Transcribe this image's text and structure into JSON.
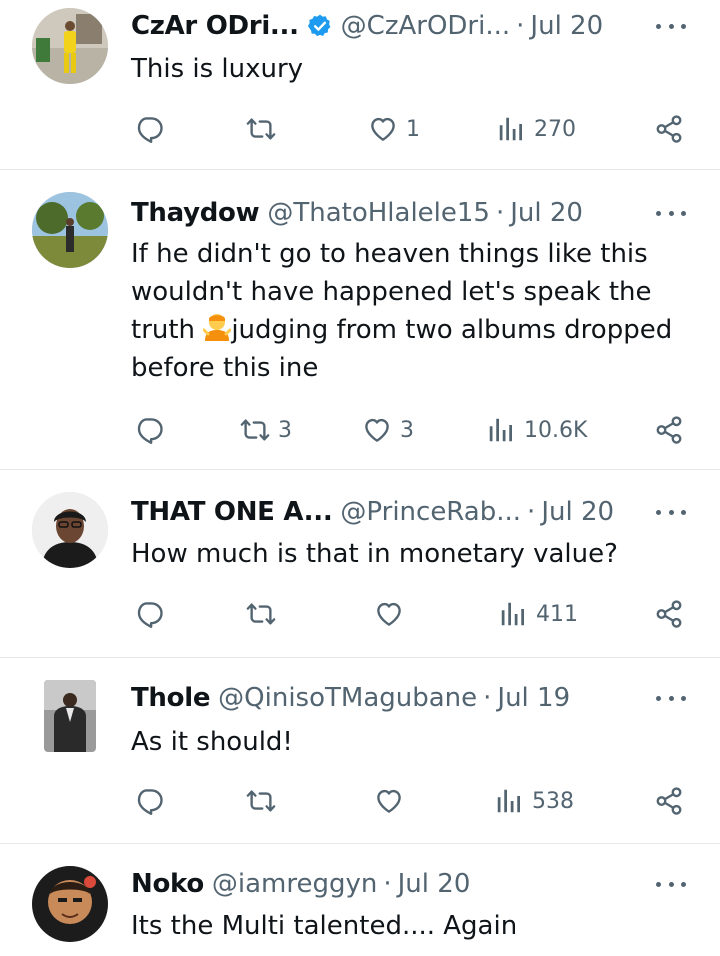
{
  "tweets": [
    {
      "name": "CzAr ODri...",
      "verified": true,
      "handle": "@CzArODri...",
      "sep": "·",
      "date": "Jul 20",
      "text": "This is luxury",
      "replies": "",
      "retweets": "",
      "likes": "1",
      "views": "270"
    },
    {
      "name": "Thaydow",
      "verified": false,
      "handle": "@ThatoHlalele15",
      "sep": "·",
      "date": "Jul 20",
      "text_lines": [
        "If he didn't go to heaven things like this",
        "wouldn't have happened let's speak the",
        "truth",
        "judging from two albums dropped",
        "before this ine"
      ],
      "replies": "",
      "retweets": "3",
      "likes": "3",
      "views": "10.6K"
    },
    {
      "name": "THAT ONE A...",
      "verified": false,
      "handle": "@PrinceRab...",
      "sep": "·",
      "date": "Jul 20",
      "text": "How much is that in monetary value?",
      "replies": "",
      "retweets": "",
      "likes": "",
      "views": "411"
    },
    {
      "name": "Thole",
      "verified": false,
      "handle": "@QinisoTMagubane",
      "sep": "·",
      "date": "Jul 19",
      "text": "As it should!",
      "replies": "",
      "retweets": "",
      "likes": "",
      "views": "538"
    },
    {
      "name": "Noko",
      "verified": false,
      "handle": "@iamreggyn",
      "sep": "·",
      "date": "Jul 20",
      "text": "Its the Multi talented.... Again"
    }
  ],
  "icons": {
    "reply": "reply-icon",
    "retweet": "retweet-icon",
    "like": "heart-icon",
    "views": "views-icon",
    "share": "share-icon",
    "more": "more-icon",
    "verified": "verified-badge-icon"
  },
  "colors": {
    "text": "#0f1419",
    "secondary": "#536471",
    "verified": "#1d9bf0",
    "divider": "#e6e9eb"
  }
}
